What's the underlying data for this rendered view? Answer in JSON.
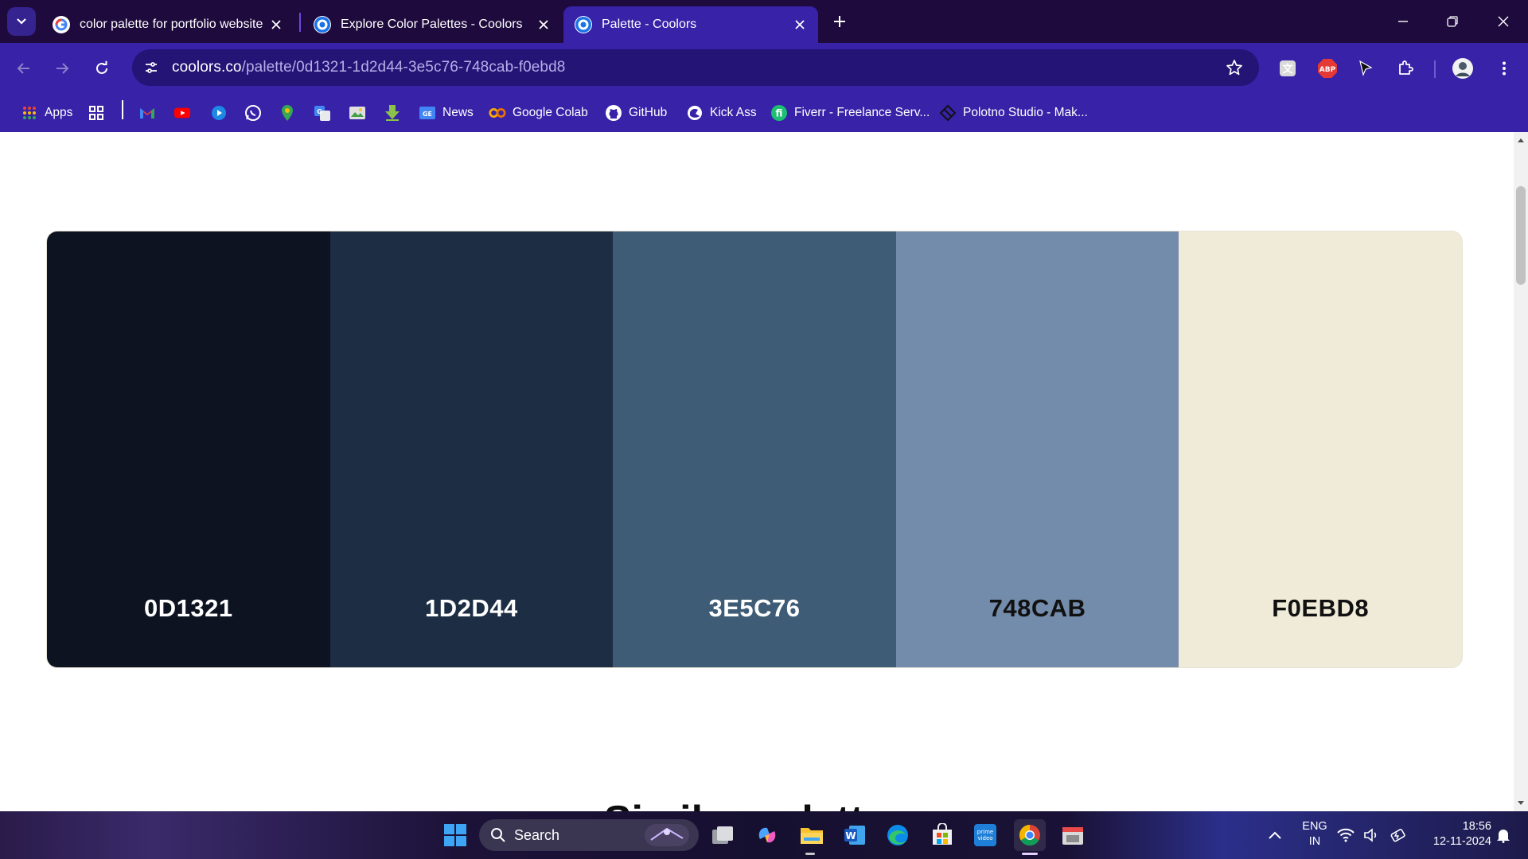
{
  "browser": {
    "tabs": [
      {
        "title": "color palette for portfolio website",
        "favicon": "google-icon",
        "active": false
      },
      {
        "title": "Explore Color Palettes - Coolors",
        "favicon": "coolors-icon",
        "active": false
      },
      {
        "title": "Palette - Coolors",
        "favicon": "coolors-icon",
        "active": true
      }
    ],
    "url": {
      "host": "coolors.co",
      "path": "/palette/0d1321-1d2d44-3e5c76-748cab-f0ebd8"
    },
    "bookmarks": [
      {
        "label": "Apps",
        "icon": "apps-grid-icon"
      },
      {
        "label": "",
        "icon": "tab-groups-icon"
      },
      {
        "label": "",
        "icon": "gmail-icon"
      },
      {
        "label": "",
        "icon": "youtube-icon"
      },
      {
        "label": "",
        "icon": "play-icon"
      },
      {
        "label": "",
        "icon": "whatsapp-icon"
      },
      {
        "label": "",
        "icon": "maps-icon"
      },
      {
        "label": "",
        "icon": "translate-icon"
      },
      {
        "label": "",
        "icon": "photos-icon"
      },
      {
        "label": "",
        "icon": "download-icon"
      },
      {
        "label": "News",
        "icon": "news-icon"
      },
      {
        "label": "Google Colab",
        "icon": "colab-icon"
      },
      {
        "label": "GitHub",
        "icon": "github-icon"
      },
      {
        "label": "Kick Ass",
        "icon": "kickass-icon"
      },
      {
        "label": "Fiverr - Freelance Serv...",
        "icon": "fiverr-icon"
      },
      {
        "label": "Polotno Studio - Mak...",
        "icon": "polotno-icon"
      }
    ],
    "extensions": [
      "translate-ext-icon",
      "adblock-plus-icon",
      "cursor-ext-icon",
      "extensions-puzzle-icon",
      "profile-avatar-icon"
    ],
    "adblock_badge": "ABP"
  },
  "palette": {
    "swatches": [
      {
        "hex": "0D1321",
        "color": "#0d1321",
        "text_color": "#ffffff"
      },
      {
        "hex": "1D2D44",
        "color": "#1d2d44",
        "text_color": "#ffffff"
      },
      {
        "hex": "3E5C76",
        "color": "#3e5c76",
        "text_color": "#ffffff"
      },
      {
        "hex": "748CAB",
        "color": "#748cab",
        "text_color": "#111111"
      },
      {
        "hex": "F0EBD8",
        "color": "#f0ebd8",
        "text_color": "#111111"
      }
    ],
    "next_heading": "Similar palettes"
  },
  "taskbar": {
    "search_label": "Search",
    "apps": [
      "windows-start-icon",
      "task-view-icon",
      "copilot-icon",
      "file-explorer-icon",
      "word-icon",
      "edge-icon",
      "store-icon",
      "prime-video-icon",
      "chrome-icon",
      "sandbox-icon"
    ],
    "language": {
      "line1": "ENG",
      "line2": "IN"
    },
    "time": "18:56",
    "date": "12-11-2024"
  }
}
